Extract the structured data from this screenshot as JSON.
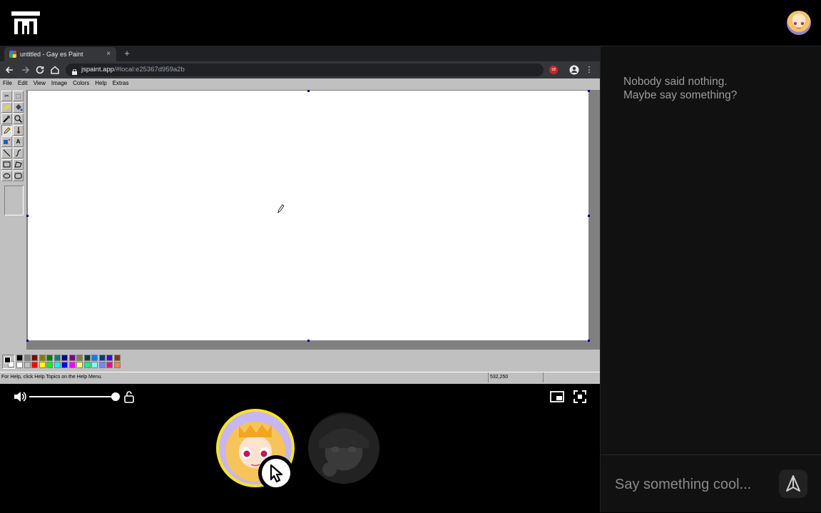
{
  "browser": {
    "tab_title": "untitled - Gay es Paint",
    "tab_close": "×",
    "new_tab": "+",
    "url_host": "jspaint.app",
    "url_path": "/#local:e25367d959a2b",
    "ext_badge": "1B"
  },
  "paint": {
    "menu": [
      "File",
      "Edit",
      "View",
      "Image",
      "Colors",
      "Help",
      "Extras"
    ],
    "status_text": "For Help, click Help Topics on the Help Menu.",
    "status_coords": "532,250",
    "palette_top": [
      "#000000",
      "#808080",
      "#800000",
      "#808000",
      "#008000",
      "#008080",
      "#000080",
      "#800080",
      "#808040",
      "#004040",
      "#0080ff",
      "#004080",
      "#4000ff",
      "#804000"
    ],
    "palette_bottom": [
      "#ffffff",
      "#c0c0c0",
      "#ff0000",
      "#ffff00",
      "#00ff00",
      "#00ffff",
      "#0000ff",
      "#ff00ff",
      "#ffff80",
      "#00ff80",
      "#80ffff",
      "#8080ff",
      "#ff0080",
      "#ff8040"
    ]
  },
  "chat": {
    "empty_line1": "Nobody said nothing.",
    "empty_line2": "Maybe say something?",
    "input_placeholder": "Say something cool..."
  },
  "controls": {
    "volume_level": 1.0
  },
  "colors": {
    "host_ring": "#f5e42a",
    "chat_bg": "#111111"
  }
}
